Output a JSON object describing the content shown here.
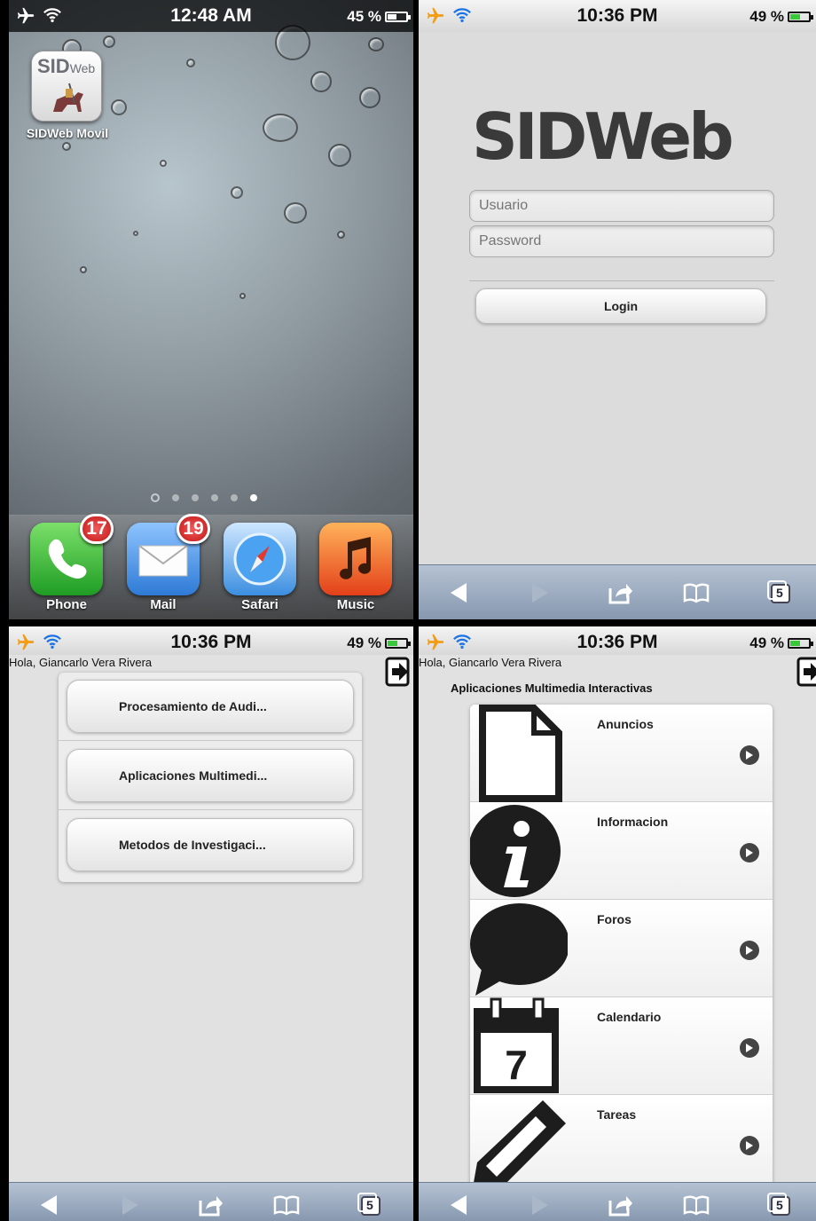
{
  "home": {
    "status": {
      "time": "12:48 AM",
      "battery": "45 %"
    },
    "app_icon": {
      "title": "SID",
      "subtitle": "Web",
      "label": "SIDWeb Movil"
    },
    "page_dots": 5,
    "dock": [
      {
        "label": "Phone",
        "badge": "17"
      },
      {
        "label": "Mail",
        "badge": "19"
      },
      {
        "label": "Safari",
        "badge": ""
      },
      {
        "label": "Music",
        "badge": ""
      }
    ]
  },
  "login": {
    "status": {
      "time": "10:36 PM",
      "battery": "49 %"
    },
    "logo_text": "SIDWeb",
    "username_placeholder": "Usuario",
    "password_placeholder": "Password",
    "login_label": "Login"
  },
  "courses": {
    "status": {
      "time": "10:36 PM",
      "battery": "49 %"
    },
    "greeting": "Hola, Giancarlo Vera Rivera",
    "items": [
      {
        "label": "Procesamiento de Audi..."
      },
      {
        "label": "Aplicaciones Multimedi..."
      },
      {
        "label": "Metodos de Investigaci..."
      }
    ]
  },
  "course_menu": {
    "status": {
      "time": "10:36 PM",
      "battery": "49 %"
    },
    "greeting": "Hola, Giancarlo Vera Rivera",
    "course_title": "Aplicaciones Multimedia Interactivas",
    "items": [
      {
        "label": "Anuncios",
        "icon": "document-icon"
      },
      {
        "label": "Informacion",
        "icon": "info-icon"
      },
      {
        "label": "Foros",
        "icon": "speech-bubble-icon"
      },
      {
        "label": "Calendario",
        "icon": "calendar-icon",
        "number": "7"
      },
      {
        "label": "Tareas",
        "icon": "pencil-icon"
      }
    ]
  },
  "toolbar": {
    "tabs_count": "5"
  },
  "colors": {
    "badge": "#c11616",
    "toolbar": "#8798af",
    "battery_low": "#ffffff",
    "battery_ok": "#38c93a"
  }
}
